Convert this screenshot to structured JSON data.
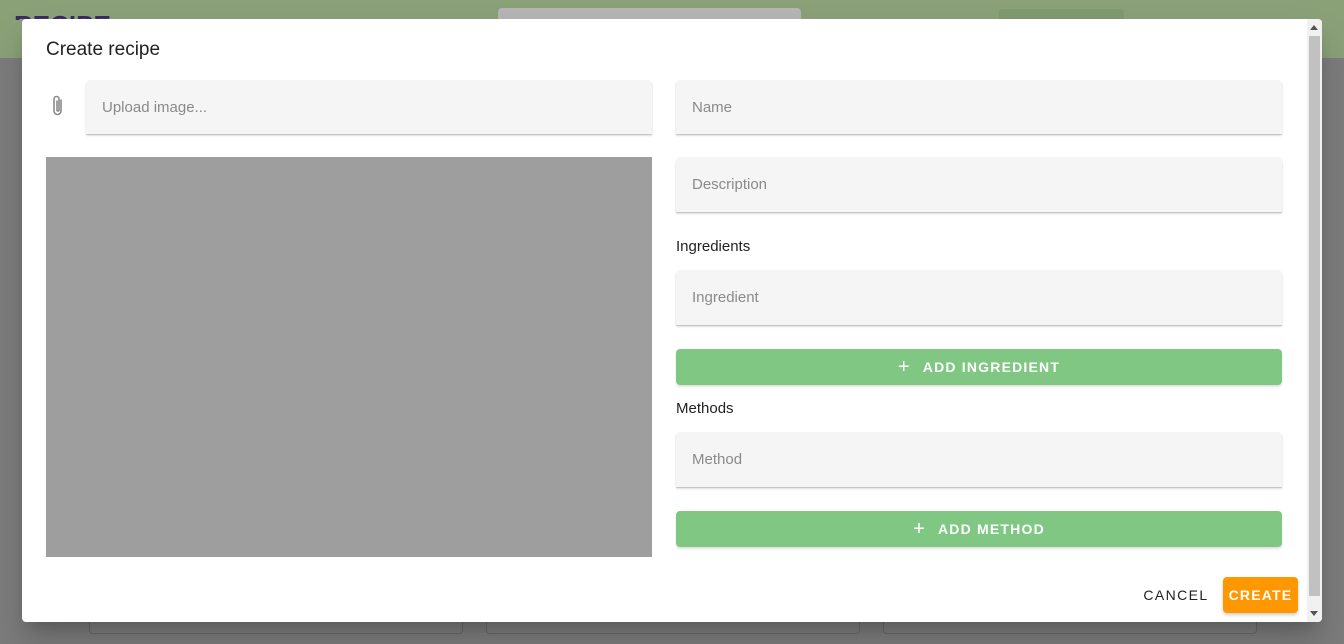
{
  "background": {
    "logo_text": "RECIPE HUB"
  },
  "dialog": {
    "title": "Create recipe",
    "upload": {
      "placeholder": "Upload image..."
    },
    "name": {
      "placeholder": "Name"
    },
    "description": {
      "placeholder": "Description"
    },
    "ingredients": {
      "label": "Ingredients",
      "placeholder": "Ingredient",
      "add_label": "ADD INGREDIENT"
    },
    "methods": {
      "label": "Methods",
      "placeholder": "Method",
      "add_label": "ADD METHOD"
    },
    "actions": {
      "cancel": "CANCEL",
      "create": "CREATE"
    }
  },
  "colors": {
    "accent_green": "#81c784",
    "create_orange": "#ff9800",
    "image_placeholder": "#9e9e9e"
  },
  "icons": [
    "paperclip-icon",
    "plus-icon"
  ]
}
